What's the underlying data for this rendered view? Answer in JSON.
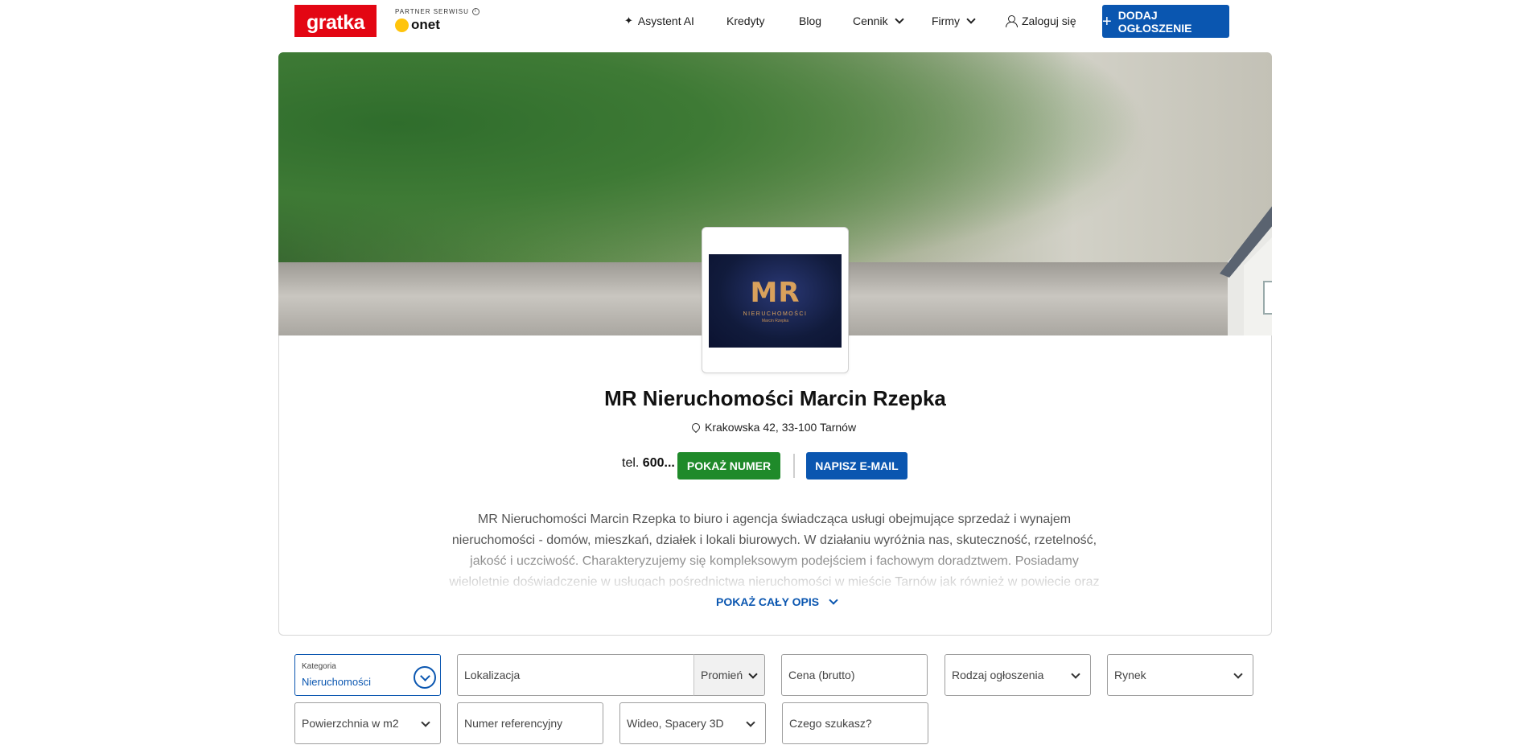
{
  "header": {
    "logo_text": "gratka",
    "partner_label": "PARTNER SERWISU",
    "partner_name": "onet",
    "nav": {
      "assistant": "Asystent AI",
      "credits": "Kredyty",
      "blog": "Blog",
      "pricing": "Cennik",
      "companies": "Firmy",
      "login": "Zaloguj się"
    },
    "add_listing": "DODAJ OGŁOSZENIE"
  },
  "profile": {
    "logo_mark": "MR",
    "logo_text": "NIERUCHOMOŚCI",
    "logo_sub": "Marcin Rzepka",
    "name": "MR Nieruchomości Marcin Rzepka",
    "address": "Krakowska 42, 33-100 Tarnów",
    "phone_prefix": "tel.",
    "phone_partial": "600...",
    "show_number": "POKAŻ NUMER",
    "write_email": "NAPISZ E-MAIL",
    "description": "MR Nieruchomości Marcin Rzepka to biuro i agencja świadcząca usługi obejmujące sprzedaż i wynajem nieruchomości - domów, mieszkań, działek i lokali biurowych. W działaniu wyróżnia nas, skuteczność, rzetelność, jakość i uczciwość. Charakteryzujemy się kompleksowym podejściem i fachowym doradztwem. Posiadamy wieloletnie doświadczenie w usługach pośrednictwa nieruchomości w mieście Tarnów jak również w powiecie oraz",
    "show_full_description": "POKAŻ CAŁY OPIS"
  },
  "filters": {
    "category_label": "Kategoria",
    "category_value": "Nieruchomości",
    "location_placeholder": "Lokalizacja",
    "radius": "Promień",
    "price_placeholder": "Cena (brutto)",
    "listing_type": "Rodzaj ogłoszenia",
    "market": "Rynek",
    "area": "Powierzchnia w m2",
    "reference_placeholder": "Numer referencyjny",
    "video": "Wideo, Spacery 3D",
    "keyword_placeholder": "Czego szukasz?"
  },
  "colors": {
    "brand_red": "#e30613",
    "primary_blue": "#0a56b0",
    "success_green": "#1f8a2a"
  }
}
